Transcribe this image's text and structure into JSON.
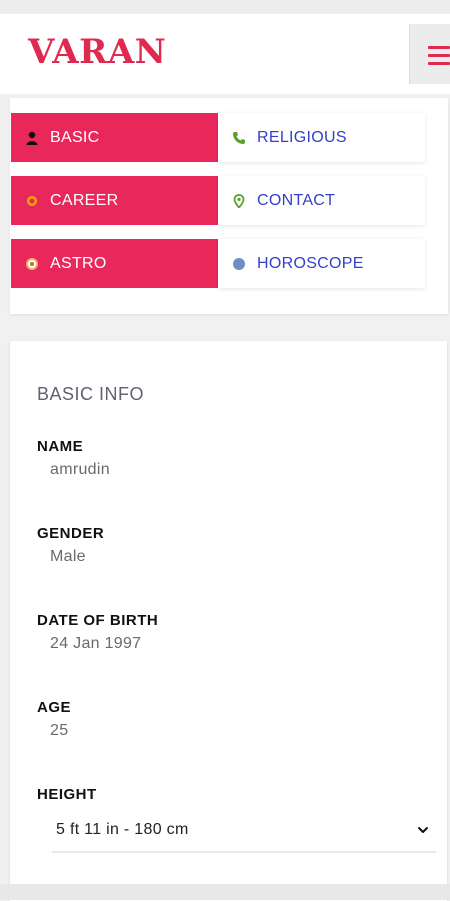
{
  "header": {
    "logo": "VARAN",
    "menu_icon": "hamburger-menu-icon"
  },
  "tabs": [
    {
      "label": "BASIC",
      "icon": "person-icon",
      "active": true
    },
    {
      "label": "RELIGIOUS",
      "icon": "phone-icon",
      "active": false
    },
    {
      "label": "CAREER",
      "icon": "sun-icon",
      "active": true
    },
    {
      "label": "CONTACT",
      "icon": "map-pin-icon",
      "active": false
    },
    {
      "label": "ASTRO",
      "icon": "astro-icon",
      "active": true
    },
    {
      "label": "HOROSCOPE",
      "icon": "planet-icon",
      "active": false
    }
  ],
  "basic_info": {
    "title": "BASIC INFO",
    "fields": [
      {
        "label": "NAME",
        "value": "amrudin"
      },
      {
        "label": "GENDER",
        "value": "Male"
      },
      {
        "label": "DATE OF BIRTH",
        "value": "24 Jan 1997"
      },
      {
        "label": "AGE",
        "value": "25"
      },
      {
        "label": "HEIGHT",
        "value": "5 ft 11 in - 180 cm"
      }
    ]
  },
  "colors": {
    "brand": "#e0294f",
    "active_tab": "#e8285a",
    "inactive_tab_text": "#3340c8"
  }
}
